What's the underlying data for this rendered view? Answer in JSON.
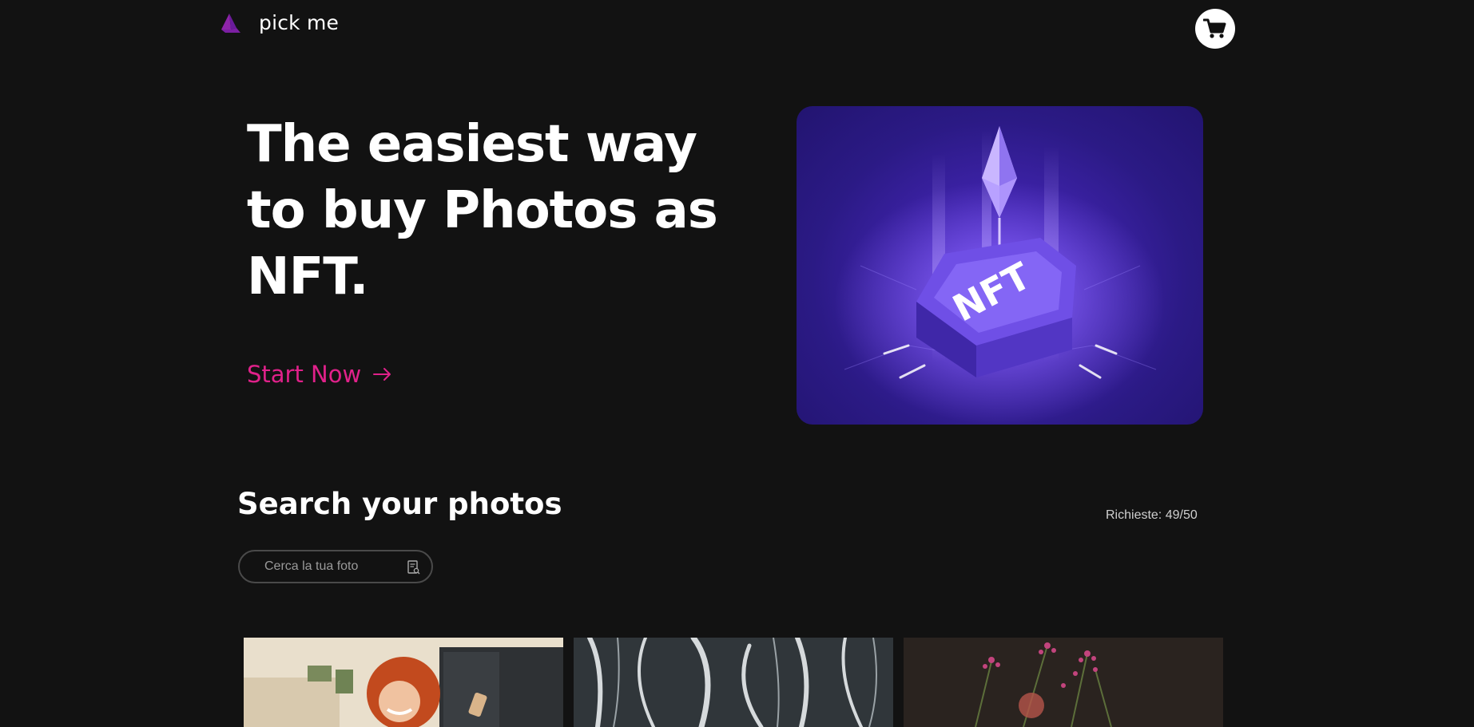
{
  "header": {
    "logo_text": "pick me",
    "logo_icon": "pyramid-logo-icon",
    "cart_icon": "shopping-cart-icon"
  },
  "hero": {
    "title": "The easiest way to buy Photos as NFT.",
    "cta_label": "Start Now",
    "cta_icon": "arrow-right-icon",
    "image_label": "NFT"
  },
  "search": {
    "title": "Search your photos",
    "requests_label": "Richieste: 49/50",
    "input_placeholder": "Cerca la tua foto",
    "input_value": "",
    "search_icon": "search-document-icon"
  },
  "gallery": {
    "photos": [
      {
        "subject": "smiling red-haired woman"
      },
      {
        "subject": "black and white marble"
      },
      {
        "subject": "pink flowers"
      }
    ]
  },
  "colors": {
    "background": "#121212",
    "accent": "#e0218a",
    "logo": "#7b1fa2",
    "hero_bg": "#3d22a8"
  }
}
